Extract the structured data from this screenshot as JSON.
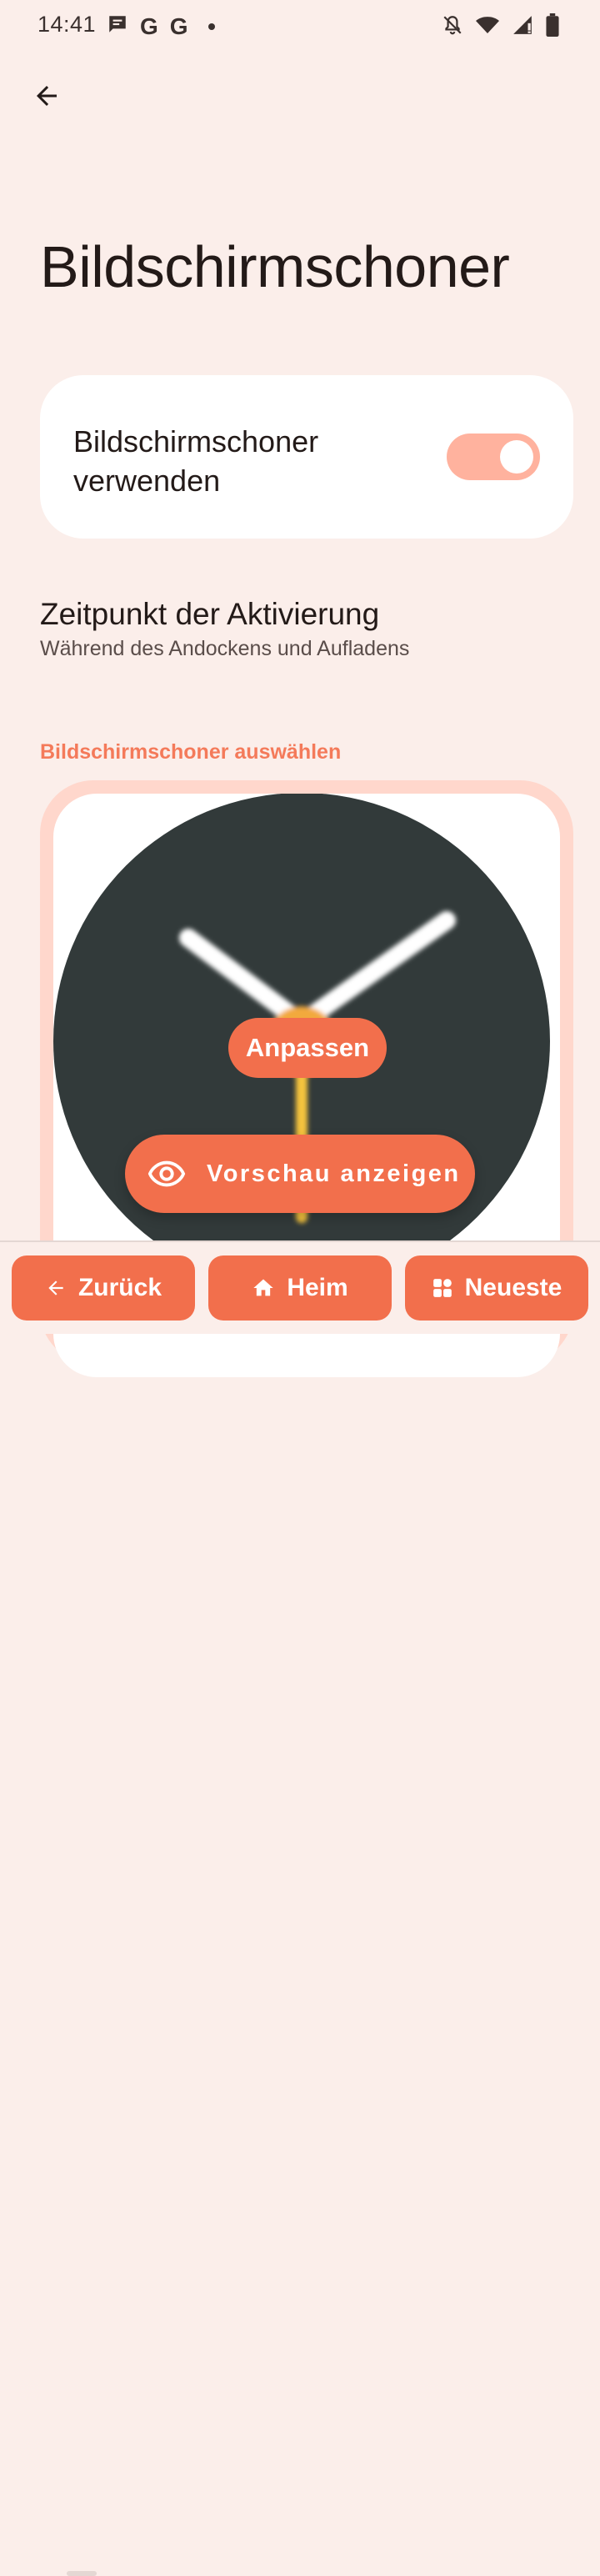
{
  "status_bar": {
    "time": "14:41",
    "left_icons": [
      "message-icon",
      "google-icon",
      "google-icon",
      "dot-icon"
    ],
    "right_icons": [
      "notifications-off-icon",
      "wifi-icon",
      "signal-icon",
      "battery-icon"
    ],
    "google_glyph": "G"
  },
  "header": {
    "back_icon": "arrow-left-icon",
    "title": "Bildschirmschoner"
  },
  "toggle_card": {
    "label": "Bildschirmschoner verwenden",
    "enabled": true
  },
  "activation": {
    "title": "Zeitpunkt der Aktivierung",
    "subtitle": "Während des Andockens und Aufladens"
  },
  "selection": {
    "header": "Bildschirmschoner auswählen",
    "customize_label": "Anpassen",
    "preview_label": "Vorschau anzeigen",
    "preview_icon": "eye-icon"
  },
  "nav": {
    "back_label": "Zurück",
    "home_label": "Heim",
    "recent_label": "Neueste"
  },
  "colors": {
    "background": "#fbeeea",
    "accent": "#f26f4c",
    "accent_text": "#f47a5a",
    "switch_track": "#ffb29e",
    "card_outline": "#ffd7cc",
    "clock_face": "#323a3a",
    "clock_center": "#f2a93c",
    "second_hand": "#f6c43c"
  }
}
